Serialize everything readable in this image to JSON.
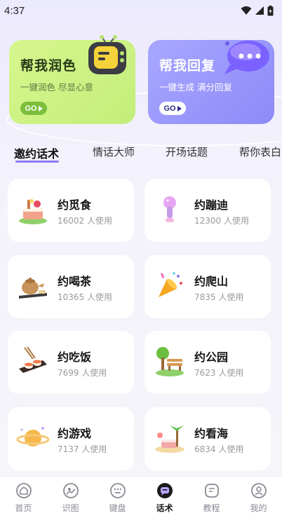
{
  "status_bar": {
    "time": "4:37"
  },
  "feature_cards": [
    {
      "title": "帮我润色",
      "subtitle": "一键润色 尽显心意",
      "go": "GO"
    },
    {
      "title": "帮我回复",
      "subtitle": "一键生成 满分回复",
      "go": "GO"
    }
  ],
  "tabs": [
    "邀约话术",
    "情话大师",
    "开场话题",
    "帮你表白"
  ],
  "active_tab": "邀约话术",
  "topics": [
    {
      "name": "约觅食",
      "users": "16002 人使用",
      "icon": "food-cake-icon"
    },
    {
      "name": "约蹦迪",
      "users": "12300 人使用",
      "icon": "microphone-icon"
    },
    {
      "name": "约喝茶",
      "users": "10365 人使用",
      "icon": "teapot-icon"
    },
    {
      "name": "约爬山",
      "users": "7835 人使用",
      "icon": "party-horn-icon"
    },
    {
      "name": "约吃饭",
      "users": "7699 人使用",
      "icon": "sushi-icon"
    },
    {
      "name": "约公园",
      "users": "7623 人使用",
      "icon": "park-bench-icon"
    },
    {
      "name": "约游戏",
      "users": "7137 人使用",
      "icon": "planet-icon"
    },
    {
      "name": "约看海",
      "users": "6834 人使用",
      "icon": "beach-icon"
    }
  ],
  "bottom_nav": [
    {
      "label": "首页",
      "icon": "home-icon"
    },
    {
      "label": "识图",
      "icon": "image-recognize-icon"
    },
    {
      "label": "键盘",
      "icon": "keyboard-icon"
    },
    {
      "label": "话术",
      "icon": "chat-bubble-icon"
    },
    {
      "label": "教程",
      "icon": "tutorial-icon"
    },
    {
      "label": "我的",
      "icon": "profile-icon"
    }
  ],
  "active_nav": "话术",
  "colors": {
    "accent": "#8e7af5",
    "green_card": "#c8f07f",
    "purple_card": "#9a97fb",
    "go_green": "#7cbe3a"
  }
}
